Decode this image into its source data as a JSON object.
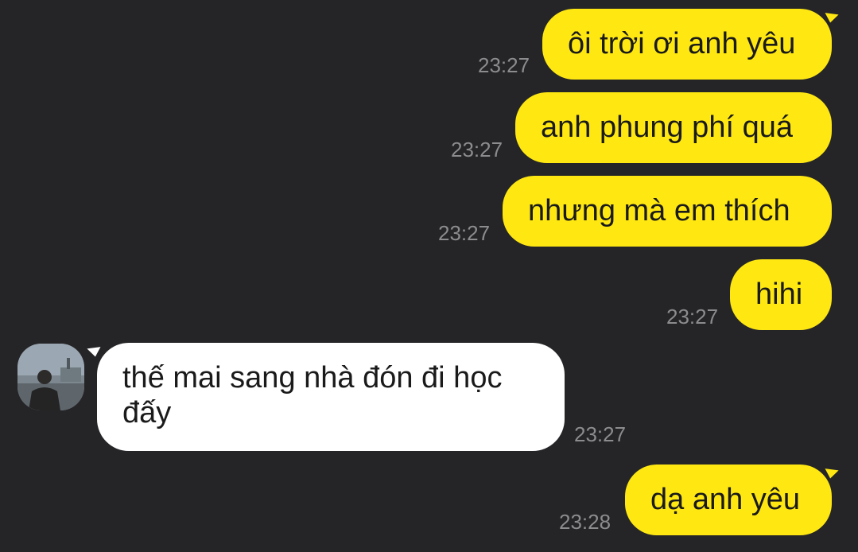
{
  "chat": {
    "messages": [
      {
        "direction": "outgoing",
        "text": "ôi trời ơi anh yêu",
        "time": "23:27"
      },
      {
        "direction": "outgoing",
        "text": "anh phung phí quá",
        "time": "23:27"
      },
      {
        "direction": "outgoing",
        "text": "nhưng mà em thích",
        "time": "23:27"
      },
      {
        "direction": "outgoing",
        "text": "hihi",
        "time": "23:27"
      },
      {
        "direction": "incoming",
        "text": "thế mai sang nhà đón đi học đấy",
        "time": "23:27"
      },
      {
        "direction": "outgoing",
        "text": "dạ anh yêu",
        "time": "23:28"
      }
    ]
  },
  "colors": {
    "background": "#252527",
    "outgoing_bubble": "#ffe812",
    "incoming_bubble": "#ffffff",
    "timestamp": "#8c8c8e"
  },
  "icons": {
    "avatar": "contact-avatar-photo"
  }
}
